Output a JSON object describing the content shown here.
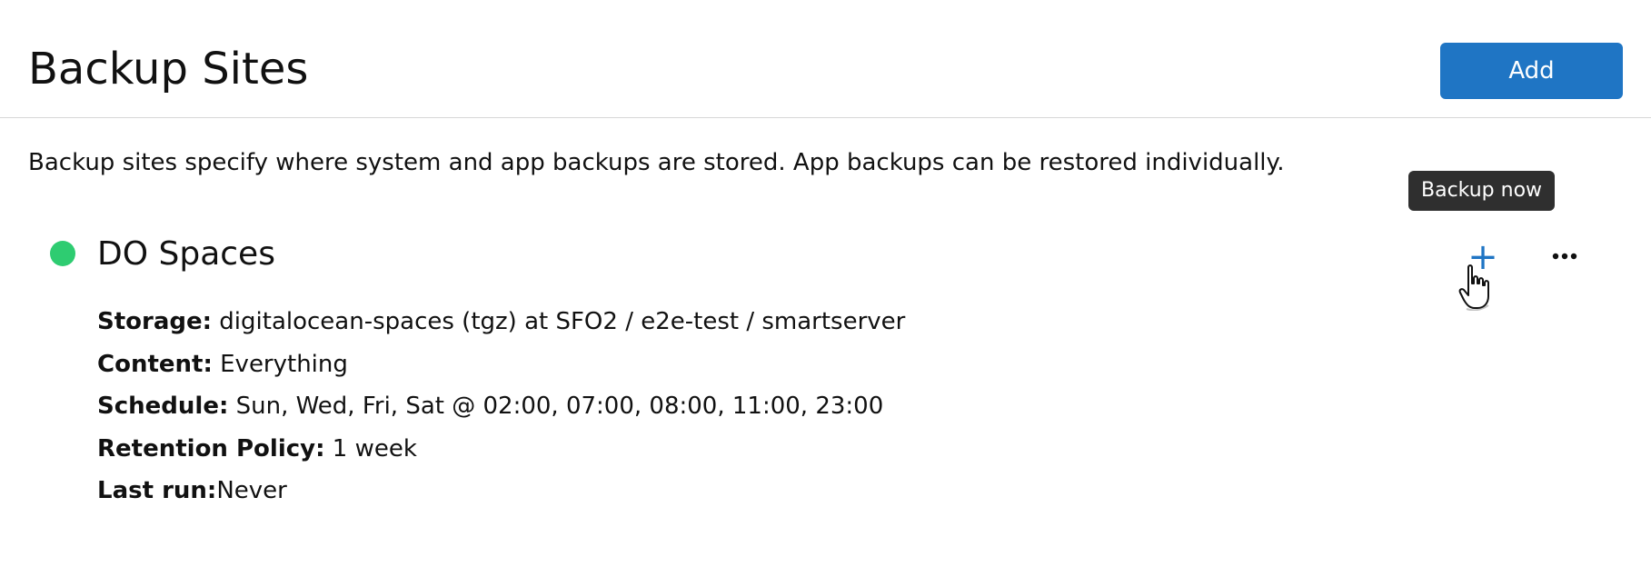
{
  "header": {
    "title": "Backup Sites",
    "add_label": "Add"
  },
  "description": "Backup sites specify where system and app backups are stored. App backups can be restored individually.",
  "tooltip": {
    "text": "Backup now"
  },
  "site": {
    "name": "DO Spaces",
    "status_color": "#2ecc71",
    "backup_now_symbol": "+",
    "more_icon": "more-icon",
    "details": {
      "storage_label": "Storage:",
      "storage_value": "digitalocean-spaces (tgz) at SFO2 / e2e-test / smartserver",
      "content_label": "Content:",
      "content_value": "Everything",
      "schedule_label": "Schedule:",
      "schedule_value": "Sun, Wed, Fri, Sat @ 02:00, 07:00, 08:00, 11:00, 23:00",
      "retention_label": "Retention Policy:",
      "retention_value": "1 week",
      "last_run_label": "Last run:",
      "last_run_value": "Never"
    }
  },
  "colors": {
    "accent": "#1f75c4",
    "tooltip_bg": "#2f2f2f",
    "status_ok": "#2ecc71"
  }
}
